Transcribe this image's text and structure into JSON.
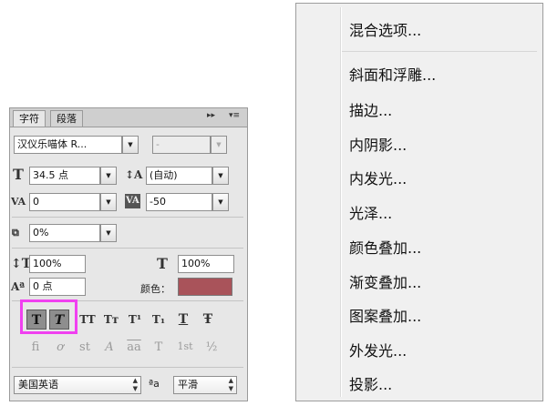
{
  "panel": {
    "tabs": [
      "字符",
      "段落"
    ],
    "tab_controls": {
      "collapse": "▸▸",
      "menu": "▾≡"
    },
    "font_family": "汉仪乐喵体 R...",
    "font_style": "-",
    "font_size": "34.5 点",
    "leading": "(自动)",
    "kerning": "0",
    "tracking": "-50",
    "scale_percent": "0%",
    "vertical_scale": "100%",
    "horizontal_scale": "100%",
    "baseline_shift": "0 点",
    "color_label": "颜色：",
    "color_value": "#a9535a",
    "style_buttons": [
      "T",
      "T",
      "TT",
      "Tт",
      "T¹",
      "T₁",
      "T",
      "Ŧ"
    ],
    "ligature_buttons": [
      "fi",
      "ơ",
      "st",
      "A",
      "aa",
      "T",
      "1st",
      "½"
    ],
    "language": "美国英语",
    "aa_label": "ªa",
    "antialias": "平滑"
  },
  "menu": {
    "items": [
      "混合选项...",
      "斜面和浮雕...",
      "描边...",
      "内阴影...",
      "内发光...",
      "光泽...",
      "颜色叠加...",
      "渐变叠加...",
      "图案叠加...",
      "外发光...",
      "投影..."
    ]
  }
}
